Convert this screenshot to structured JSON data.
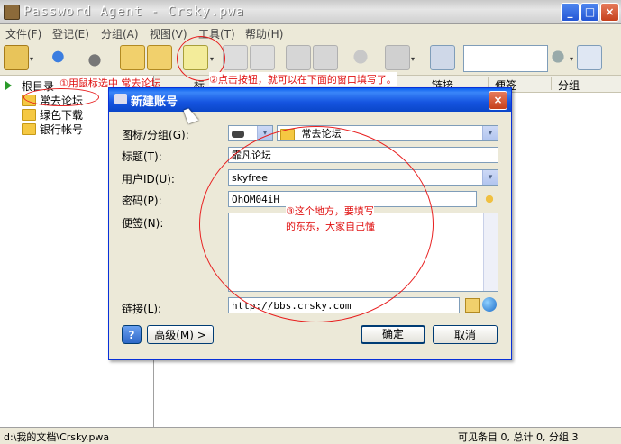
{
  "window": {
    "title": "Password Agent - Crsky.pwa",
    "minimize": "_",
    "maximize": "□",
    "close": "×"
  },
  "menu": [
    "文件(F)",
    "登记(E)",
    "分组(A)",
    "视图(V)",
    "工具(T)",
    "帮助(H)"
  ],
  "toolbar": {
    "search_value": "",
    "dropdown_arrow": "▾"
  },
  "tree": {
    "root_label": "根目录",
    "items": [
      "常去论坛",
      "绿色下载",
      "银行帐号"
    ]
  },
  "list": {
    "columns": [
      "标",
      "链接",
      "便签",
      "分组"
    ]
  },
  "annotations": {
    "step1": "①用鼠标选中 常去论坛",
    "step2": "②点击按钮，就可以在下面的窗口填写了。",
    "step3_line1": "③这个地方，要填写",
    "step3_line2": "的东东，大家自己懂"
  },
  "dialog": {
    "title": "新建账号",
    "close": "×",
    "icon_group_label": "图标/分组(G):",
    "group_value": "常去论坛",
    "title_label": "标题(T):",
    "title_value": "霏凡论坛",
    "userid_label": "用户ID(U):",
    "userid_value": "skyfree",
    "password_label": "密码(P):",
    "password_value": "OhOM04iH",
    "note_label": "便签(N):",
    "note_value": "",
    "link_label": "链接(L):",
    "link_value": "http://bbs.crsky.com",
    "help_button": "?",
    "advanced_button": "高级(M) >",
    "ok_button": "确定",
    "cancel_button": "取消"
  },
  "statusbar": {
    "path": "d:\\我的文档\\Crsky.pwa",
    "counts": "可见条目 0, 总计 0, 分组 3"
  }
}
